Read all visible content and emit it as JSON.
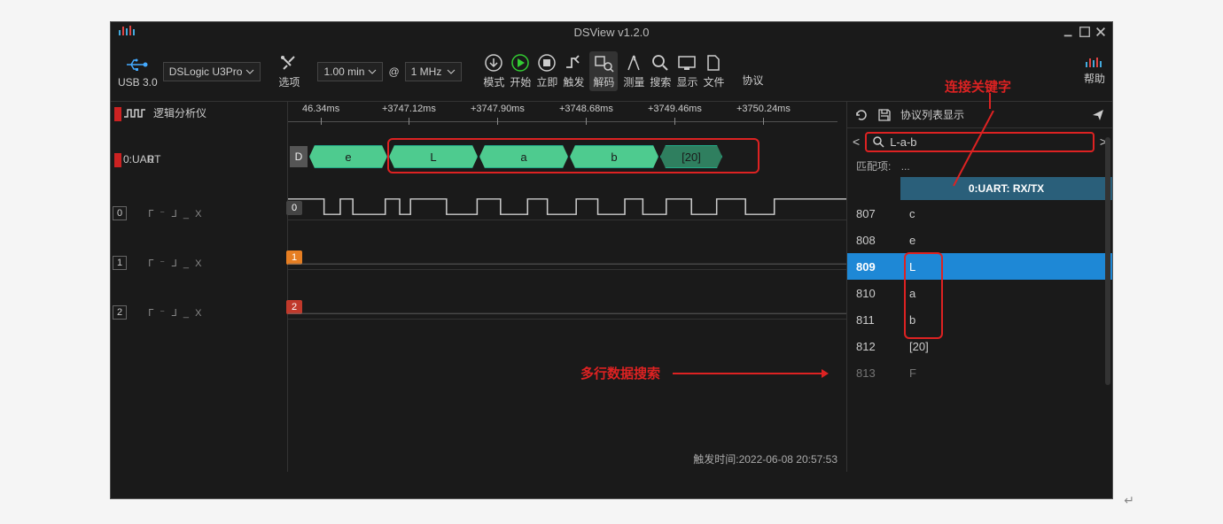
{
  "title": "DSView v1.2.0",
  "toolbar": {
    "usb_label": "USB 3.0",
    "device": "DSLogic U3Pro",
    "options_label": "选项",
    "duration": "1.00 min",
    "at": "@",
    "sample_rate": "1 MHz",
    "mode": "模式",
    "start": "开始",
    "instant": "立即",
    "trigger": "触发",
    "decode": "解码",
    "measure": "测量",
    "search": "搜索",
    "display": "显示",
    "file": "文件",
    "protocol": "协议",
    "help": "帮助"
  },
  "timeline": {
    "ticks": [
      "46.34ms",
      "+3747.12ms",
      "+3747.90ms",
      "+3748.68ms",
      "+3749.46ms",
      "+3750.24ms"
    ]
  },
  "sidebar": {
    "la_label": "逻辑分析仪",
    "ch0_proto": "0:UART",
    "ch0_val": "0",
    "ch0": "0",
    "ch1": "1",
    "ch2": "2",
    "trig_pattern": "ᒥ ⁻ ᒧ _ X"
  },
  "packets": {
    "d": "D",
    "items": [
      "e",
      "L",
      "a",
      "b",
      "[20]"
    ]
  },
  "panel": {
    "header": "协议列表显示",
    "search_value": "L-a-b",
    "match_label": "匹配项:",
    "match_val": "...",
    "column_header": "0:UART: RX/TX",
    "rows": [
      {
        "idx": "807",
        "val": "c"
      },
      {
        "idx": "808",
        "val": "e"
      },
      {
        "idx": "809",
        "val": "L"
      },
      {
        "idx": "810",
        "val": "a"
      },
      {
        "idx": "811",
        "val": "b"
      },
      {
        "idx": "812",
        "val": "[20]"
      },
      {
        "idx": "813",
        "val": "F"
      }
    ]
  },
  "status": {
    "trigger_time_label": "触发时间:",
    "trigger_time": "2022-06-08 20:57:53"
  },
  "annotations": {
    "keyword": "连接关键字",
    "multiline": "多行数据搜索"
  }
}
